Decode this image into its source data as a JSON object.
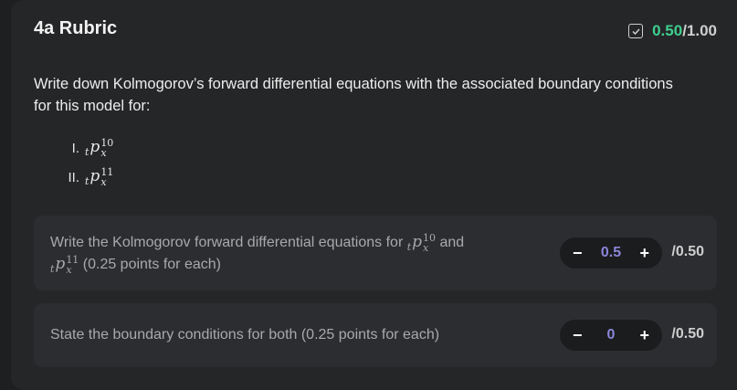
{
  "header": {
    "title": "4a Rubric",
    "score_value": "0.50",
    "score_max": "/1.00"
  },
  "prompt": {
    "text": "Write down Kolmogorov’s forward differential equations with the associated boundary conditions for this model for:",
    "items": [
      {
        "numeral": "I.",
        "pre": "t",
        "base": "p",
        "sup": "10",
        "sub": "x"
      },
      {
        "numeral": "II.",
        "pre": "t",
        "base": "p",
        "sup": "11",
        "sub": "x"
      }
    ]
  },
  "criteria": [
    {
      "text_before": "Write the Kolmogorov forward differential equations for",
      "term1": {
        "pre": "t",
        "base": "p",
        "sup": "10",
        "sub": "x"
      },
      "text_and": "and",
      "term2": {
        "pre": "t",
        "base": "p",
        "sup": "11",
        "sub": "x"
      },
      "text_after": "(0.25 points for each)",
      "value": "0.5",
      "max": "/0.50",
      "minus": "−",
      "plus": "+"
    },
    {
      "text": "State the boundary conditions for both (0.25 points for each)",
      "value": "0",
      "max": "/0.50",
      "minus": "−",
      "plus": "+"
    }
  ],
  "colors": {
    "score": "#3ecf8e",
    "stepper_value": "#8a86d8",
    "card_bg": "#252628",
    "criterion_bg": "#2c2d30"
  },
  "icons": {
    "score_icon": "checkbox-check-icon"
  }
}
